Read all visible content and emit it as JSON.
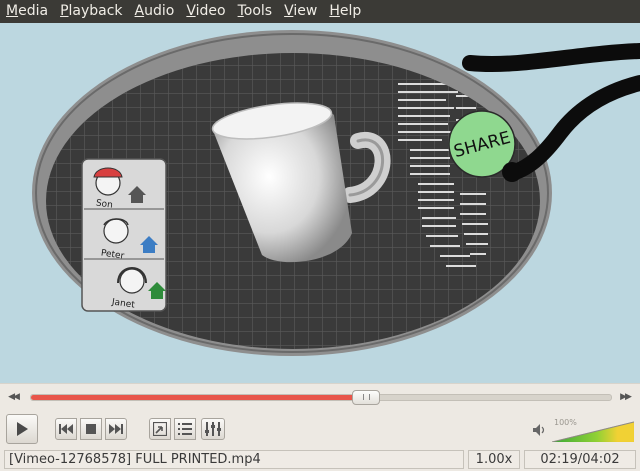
{
  "menu": {
    "items": [
      {
        "label": "Media",
        "mnemonic": "M",
        "rest": "edia"
      },
      {
        "label": "Playback",
        "mnemonic": "P",
        "rest": "layback"
      },
      {
        "label": "Audio",
        "mnemonic": "A",
        "rest": "udio"
      },
      {
        "label": "Video",
        "mnemonic": "V",
        "rest": "ideo"
      },
      {
        "label": "Tools",
        "mnemonic": "T",
        "rest": "ools"
      },
      {
        "label": "View",
        "mnemonic": "V",
        "rest": "iew"
      },
      {
        "label": "Help",
        "mnemonic": "H",
        "rest": "elp"
      }
    ]
  },
  "video_frame": {
    "share_label": "SHARE",
    "contacts": [
      {
        "name": "Son",
        "home_color": "#555555"
      },
      {
        "name": "Peter",
        "home_color": "#3c7dc4"
      },
      {
        "name": "Janet",
        "home_color": "#2e8b3a"
      }
    ]
  },
  "playback": {
    "progress": 0.575
  },
  "controls": {
    "play_icon": "play-icon",
    "prev_icon": "skip-back-icon",
    "stop_icon": "stop-icon",
    "next_icon": "skip-forward-icon",
    "fullscreen_icon": "fullscreen-icon",
    "playlist_icon": "playlist-icon",
    "extended_icon": "equalizer-icon"
  },
  "volume": {
    "percent_label": "100%",
    "level": 1.0,
    "accent": "#2fa52f"
  },
  "status": {
    "title": "[Vimeo-12768578] FULL PRINTED.mp4",
    "speed": "1.00x",
    "time": "02:19/04:02"
  },
  "colors": {
    "menubar": "#3b3a36",
    "seek_fill": "#e8554a"
  }
}
